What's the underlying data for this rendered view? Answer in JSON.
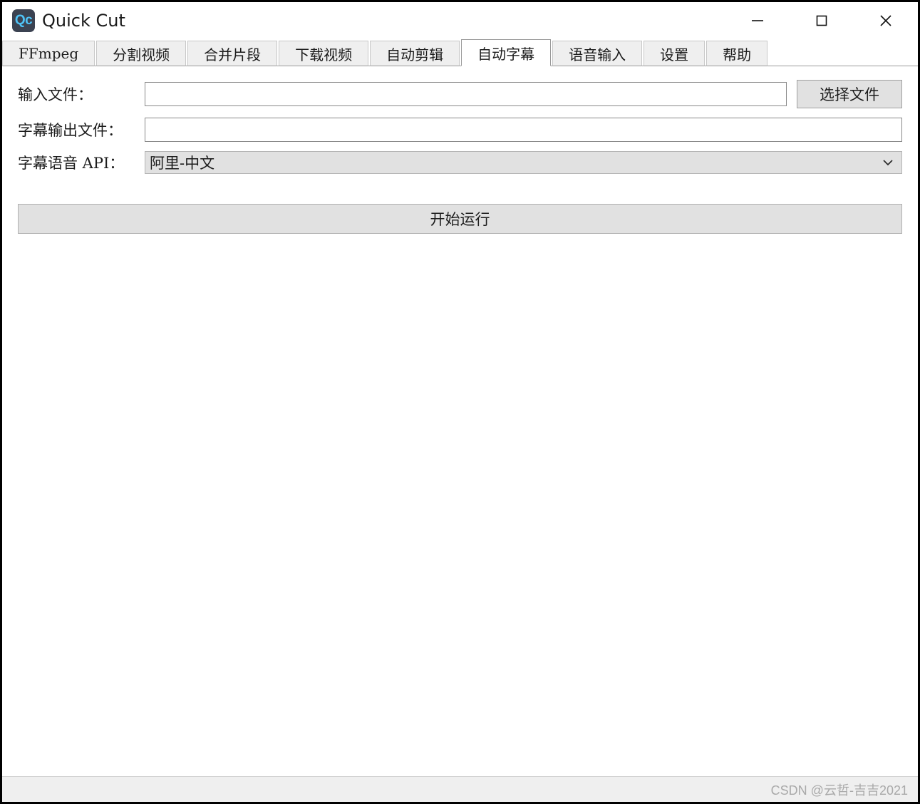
{
  "window": {
    "title": "Quick Cut",
    "icon_text": "Qc",
    "icon_bg": "#3b4251",
    "icon_fg": "#4fc3f7",
    "controls": {
      "minimize": "minimize-icon",
      "maximize": "maximize-icon",
      "close": "close-icon"
    }
  },
  "tabs": [
    {
      "label": "FFmpeg",
      "active": false
    },
    {
      "label": "分割视频",
      "active": false
    },
    {
      "label": "合并片段",
      "active": false
    },
    {
      "label": "下载视频",
      "active": false
    },
    {
      "label": "自动剪辑",
      "active": false
    },
    {
      "label": "自动字幕",
      "active": true
    },
    {
      "label": "语音输入",
      "active": false
    },
    {
      "label": "设置",
      "active": false
    },
    {
      "label": "帮助",
      "active": false
    }
  ],
  "form": {
    "input_file": {
      "label": "输入文件：",
      "value": "",
      "placeholder": "",
      "browse_label": "选择文件"
    },
    "output_file": {
      "label": "字幕输出文件：",
      "value": "",
      "placeholder": ""
    },
    "api": {
      "label": "字幕语音 API：",
      "selected": "阿里-中文",
      "options": [
        "阿里-中文"
      ],
      "chevron": "chevron-down-icon"
    },
    "run_label": "开始运行"
  },
  "statusbar": {
    "watermark": "CSDN @云哲-吉吉2021"
  }
}
